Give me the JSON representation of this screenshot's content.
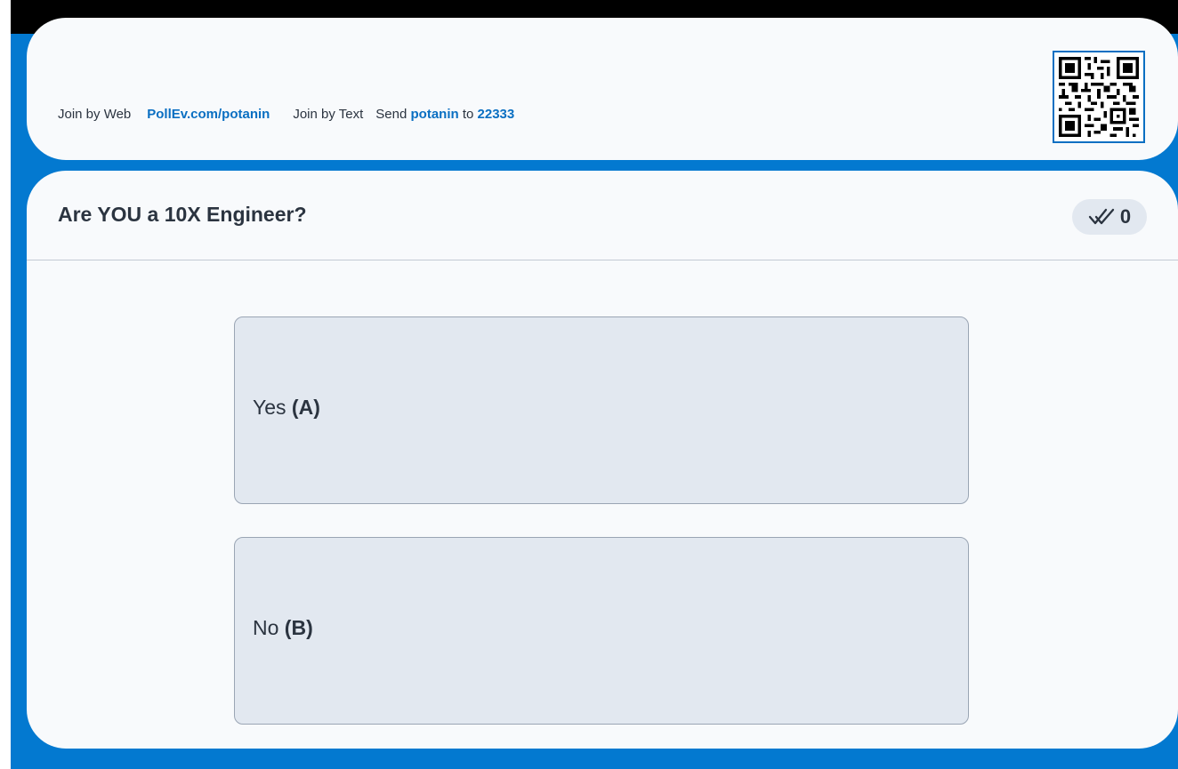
{
  "join": {
    "web_label": "Join by Web",
    "web_url": "PollEv.com/potanin",
    "text_label": "Join by Text",
    "send_word": "Send",
    "keyword": "potanin",
    "to_word": "to",
    "number": "22333"
  },
  "qr": {
    "icon": "qr-code-icon",
    "accent": "#0a6fc2"
  },
  "poll": {
    "title": "Are YOU a 10X Engineer?",
    "response_count": "0",
    "response_icon": "double-check-icon",
    "options": [
      {
        "text": "Yes",
        "letter": "(A)"
      },
      {
        "text": "No",
        "letter": "(B)"
      }
    ]
  },
  "colors": {
    "frame": "#0379d0",
    "card": "#f8fafc",
    "option_bg": "#e2e8f0",
    "link": "#0a6fc2",
    "text": "#2b3440"
  }
}
